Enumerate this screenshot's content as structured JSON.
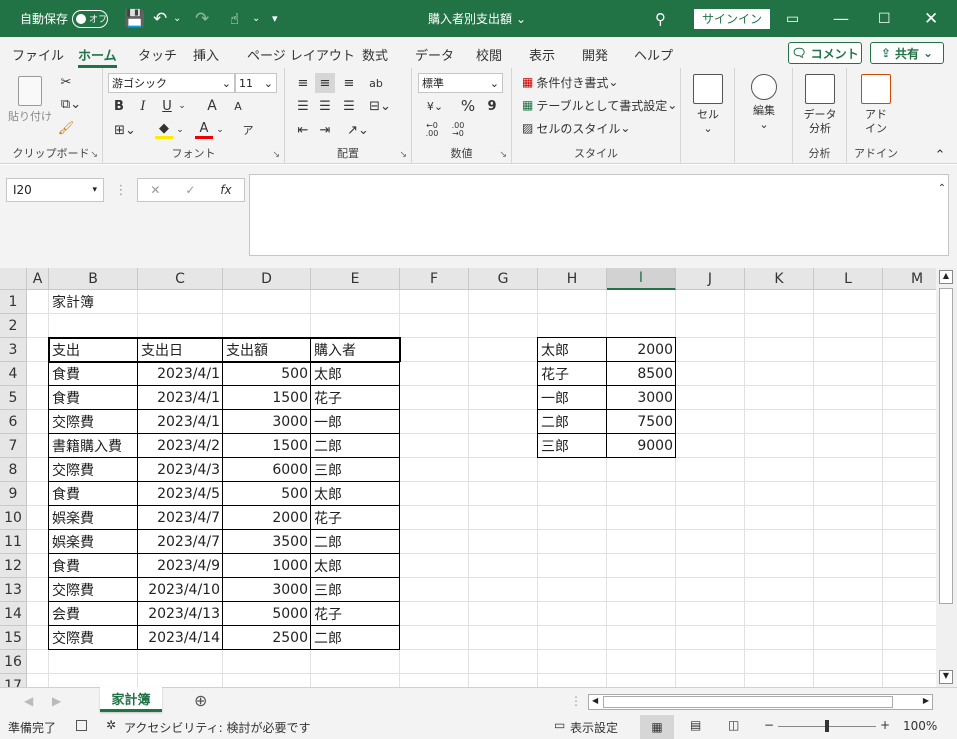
{
  "titlebar": {
    "autosave_label": "自動保存",
    "toggle_state": "オフ",
    "doc_title": "購入者別支出額",
    "signin_label": "サインイン",
    "colors": {
      "brand": "#217346"
    }
  },
  "menu": {
    "tabs": [
      "ファイル",
      "ホーム",
      "タッチ",
      "挿入",
      "ページ レイアウト",
      "数式",
      "データ",
      "校閲",
      "表示",
      "開発",
      "ヘルプ"
    ],
    "active_tab": "ホーム",
    "comment_label": "コメント",
    "share_label": "共有"
  },
  "ribbon": {
    "clipboard": {
      "label": "クリップボード",
      "paste_label": "貼り付け"
    },
    "font": {
      "label": "フォント",
      "font_name": "游ゴシック",
      "font_size": "11",
      "bold": "B",
      "italic": "I",
      "underline": "U",
      "grow": "A",
      "shrink": "A",
      "font_color": "A",
      "phonetic": "ア"
    },
    "alignment": {
      "label": "配置",
      "wrap": "ab"
    },
    "number": {
      "label": "数値",
      "format": "標準",
      "percent": "%",
      "comma": "9",
      "inc": "←0 .00",
      "dec": ".00 →0"
    },
    "styles": {
      "label": "スタイル",
      "conditional": "条件付き書式",
      "table": "テーブルとして書式設定",
      "cell_styles": "セルのスタイル"
    },
    "cells": {
      "label": "セル"
    },
    "editing": {
      "label": "編集"
    },
    "analysis": {
      "label": "分析",
      "data_analysis_1": "データ",
      "data_analysis_2": "分析"
    },
    "addins": {
      "label": "アドイン",
      "addin_1": "アド",
      "addin_2": "イン"
    }
  },
  "formula_bar": {
    "name_box": "I20",
    "fx": "fx",
    "formula": ""
  },
  "grid": {
    "columns": [
      "A",
      "B",
      "C",
      "D",
      "E",
      "F",
      "G",
      "H",
      "I",
      "J",
      "K",
      "L",
      "M"
    ],
    "selected_column": "I",
    "rows": [
      "1",
      "2",
      "3",
      "4",
      "5",
      "6",
      "7",
      "8",
      "9",
      "10",
      "11",
      "12",
      "13",
      "14",
      "15",
      "16",
      "17"
    ],
    "title": "家計簿",
    "table_headers": [
      "支出",
      "支出日",
      "支出額",
      "購入者"
    ],
    "table_rows": [
      [
        "食費",
        "2023/4/1",
        "500",
        "太郎"
      ],
      [
        "食費",
        "2023/4/1",
        "1500",
        "花子"
      ],
      [
        "交際費",
        "2023/4/1",
        "3000",
        "一郎"
      ],
      [
        "書籍購入費",
        "2023/4/2",
        "1500",
        "二郎"
      ],
      [
        "交際費",
        "2023/4/3",
        "6000",
        "三郎"
      ],
      [
        "食費",
        "2023/4/5",
        "500",
        "太郎"
      ],
      [
        "娯楽費",
        "2023/4/7",
        "2000",
        "花子"
      ],
      [
        "娯楽費",
        "2023/4/7",
        "3500",
        "二郎"
      ],
      [
        "食費",
        "2023/4/9",
        "1000",
        "太郎"
      ],
      [
        "交際費",
        "2023/4/10",
        "3000",
        "三郎"
      ],
      [
        "会費",
        "2023/4/13",
        "5000",
        "花子"
      ],
      [
        "交際費",
        "2023/4/14",
        "2500",
        "二郎"
      ]
    ],
    "summary": [
      [
        "太郎",
        "2000"
      ],
      [
        "花子",
        "8500"
      ],
      [
        "一郎",
        "3000"
      ],
      [
        "二郎",
        "7500"
      ],
      [
        "三郎",
        "9000"
      ]
    ]
  },
  "sheet_tabs": [
    "家計簿"
  ],
  "status": {
    "ready": "準備完了",
    "accessibility": "アクセシビリティ: 検討が必要です",
    "display_settings": "表示設定",
    "zoom": "100%",
    "minus": "−",
    "plus": "+"
  }
}
